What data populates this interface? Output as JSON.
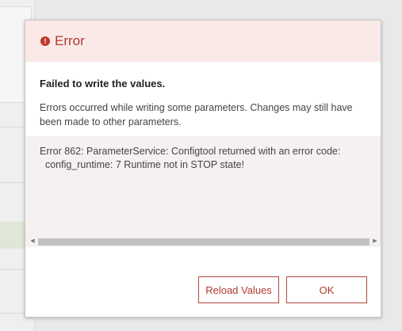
{
  "dialog": {
    "title": "Error",
    "icon": "error-icon",
    "message_title": "Failed to write the values.",
    "message_text": "Errors occurred while writing some parameters. Changes may still have been made to other parameters.",
    "detail_line_1": "Error 862: ParameterService: Configtool returned with an error code:",
    "detail_line_2": "  config_runtime: 7 Runtime not in STOP state!",
    "buttons": {
      "reload": "Reload Values",
      "ok": "OK"
    }
  },
  "colors": {
    "accent": "#b03a2e",
    "header_bg": "#fbe9e8",
    "detail_bg": "#f4f1f0"
  }
}
